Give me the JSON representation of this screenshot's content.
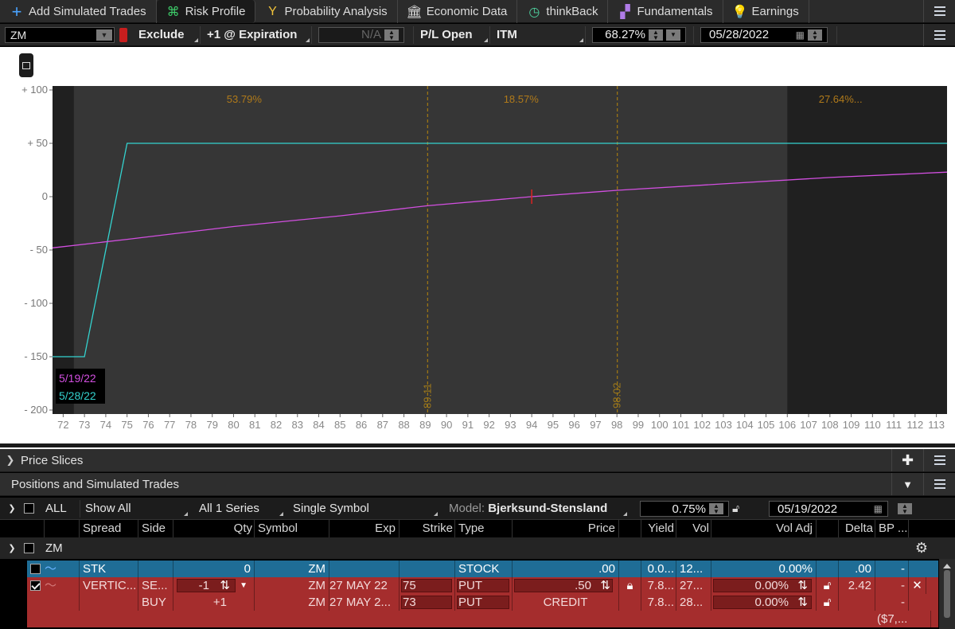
{
  "tabs": [
    {
      "label": "Add Simulated Trades",
      "icon": "plus-icon",
      "active": false
    },
    {
      "label": "Risk Profile",
      "icon": "risk-profile-icon",
      "active": true
    },
    {
      "label": "Probability Analysis",
      "icon": "probability-icon",
      "active": false
    },
    {
      "label": "Economic Data",
      "icon": "bank-icon",
      "active": false
    },
    {
      "label": "thinkBack",
      "icon": "clock-back-icon",
      "active": false
    },
    {
      "label": "Fundamentals",
      "icon": "blocks-icon",
      "active": false
    },
    {
      "label": "Earnings",
      "icon": "bulb-icon",
      "active": false
    }
  ],
  "controls": {
    "symbol": "ZM",
    "exclude": "Exclude",
    "expiration": "+1 @ Expiration",
    "na": "N/A",
    "pl_open": "P/L Open",
    "itm": "ITM",
    "prob": "68.27%",
    "date": "05/28/2022"
  },
  "chart_data": {
    "type": "line",
    "ylim": [
      -200,
      100
    ],
    "xlim": [
      71.5,
      113.5
    ],
    "yticks": [
      100,
      50,
      0,
      -50,
      -100,
      -150,
      -200
    ],
    "ytick_labels": [
      "+ 100",
      "+ 50",
      "0",
      "- 50",
      "- 100",
      "- 150",
      "- 200"
    ],
    "xticks": [
      72,
      73,
      74,
      75,
      76,
      77,
      78,
      79,
      80,
      81,
      82,
      83,
      84,
      85,
      86,
      87,
      88,
      89,
      90,
      91,
      92,
      93,
      94,
      95,
      96,
      97,
      98,
      99,
      100,
      101,
      102,
      103,
      104,
      105,
      106,
      107,
      108,
      109,
      110,
      111,
      112,
      113
    ],
    "probabilities": [
      {
        "label": "53.79%",
        "x_center": 80.5
      },
      {
        "label": "18.57%",
        "x_center": 93.5
      },
      {
        "label": "27.64%...",
        "x_center": 108.5
      }
    ],
    "breakevens": [
      {
        "x": 89.11,
        "label": "89.11"
      },
      {
        "x": 98.02,
        "label": "98.02"
      }
    ],
    "shaded_left_until": 72.5,
    "shaded_right_from": 106,
    "series": [
      {
        "name": "5/28/22",
        "color": "#34d3cf",
        "points": [
          [
            71.5,
            -150
          ],
          [
            73,
            -150
          ],
          [
            75,
            50
          ],
          [
            113.5,
            50
          ]
        ]
      },
      {
        "name": "5/19/22",
        "color": "#d24fe0",
        "points": [
          [
            71.5,
            -48
          ],
          [
            75,
            -40
          ],
          [
            80,
            -28
          ],
          [
            85,
            -18
          ],
          [
            89.11,
            -8.5
          ],
          [
            94,
            0
          ],
          [
            98.02,
            6
          ],
          [
            103,
            12
          ],
          [
            108,
            18
          ],
          [
            113.5,
            23
          ]
        ]
      }
    ],
    "marker_x": 94
  },
  "sections": {
    "price_slices": "Price Slices",
    "positions": "Positions and Simulated Trades"
  },
  "pos_toolbar": {
    "all": "ALL",
    "show_all": "Show All",
    "series": "All 1 Series",
    "single_symbol": "Single Symbol",
    "model_label": "Model:",
    "model": "Bjerksund-Stensland",
    "rate": "0.75%",
    "date": "05/19/2022"
  },
  "table": {
    "headers": [
      "Spread",
      "Side",
      "Qty",
      "Symbol",
      "Exp",
      "Strike",
      "Type",
      "Price",
      "Yield",
      "Vol",
      "Vol Adj",
      "Delta",
      "BP ..."
    ],
    "group": "ZM",
    "rows": [
      {
        "spread": "STK",
        "side": "",
        "qty": "0",
        "symbol": "ZM",
        "exp": "",
        "strike": "",
        "type": "STOCK",
        "price": ".00",
        "yield": "0.0...",
        "vol": "12...",
        "voladj": "0.00%",
        "delta": ".00",
        "bp": "-"
      },
      {
        "spread": "VERTIC...",
        "side": "SE...",
        "qty": "-1",
        "symbol": "ZM",
        "exp": "27 MAY 22",
        "strike": "75",
        "type": "PUT",
        "price": ".50",
        "yield": "7.8...",
        "vol": "27...",
        "voladj": "0.00%",
        "delta": "2.42",
        "bp": "-"
      },
      {
        "spread": "",
        "side": "BUY",
        "qty": "+1",
        "symbol": "ZM",
        "exp": "27 MAY 2...",
        "strike": "73",
        "type": "PUT",
        "price": "CREDIT",
        "yield": "7.8...",
        "vol": "28...",
        "voladj": "0.00%",
        "delta": "",
        "bp": "-"
      },
      {
        "spread": "",
        "side": "",
        "qty": "",
        "symbol": "",
        "exp": "",
        "strike": "",
        "type": "",
        "price": "",
        "yield": "",
        "vol": "",
        "voladj": "",
        "delta": "",
        "bp": "($7,..."
      }
    ]
  }
}
